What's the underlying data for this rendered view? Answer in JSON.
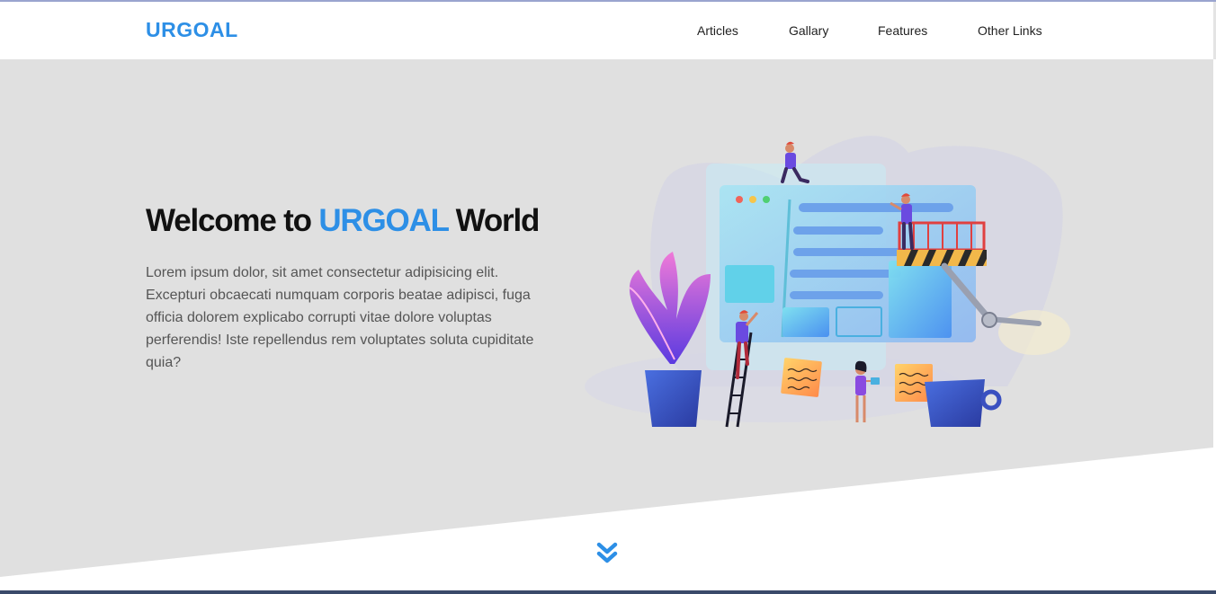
{
  "navbar": {
    "brand": "URGOAL",
    "links": [
      "Articles",
      "Gallary",
      "Features",
      "Other Links"
    ]
  },
  "hero": {
    "title_prefix": "Welcome to ",
    "title_accent": "URGOAL",
    "title_suffix": " World",
    "text": "Lorem ipsum dolor, sit amet consectetur adipisicing elit. Excepturi obcaecati numquam corporis beatae adipisci, fuga officia dolorem explicabo corrupti vitae dolore voluptas perferendis! Iste repellendus rem voluptates soluta cupiditate quia?",
    "illustration_icon": "website-building-illustration"
  },
  "scroll": {
    "icon": "double-chevron-down-icon"
  },
  "colors": {
    "accent": "#2d8fe6",
    "hero_bg": "#e0e0e0",
    "heading": "#111111",
    "body_text": "#555555"
  }
}
